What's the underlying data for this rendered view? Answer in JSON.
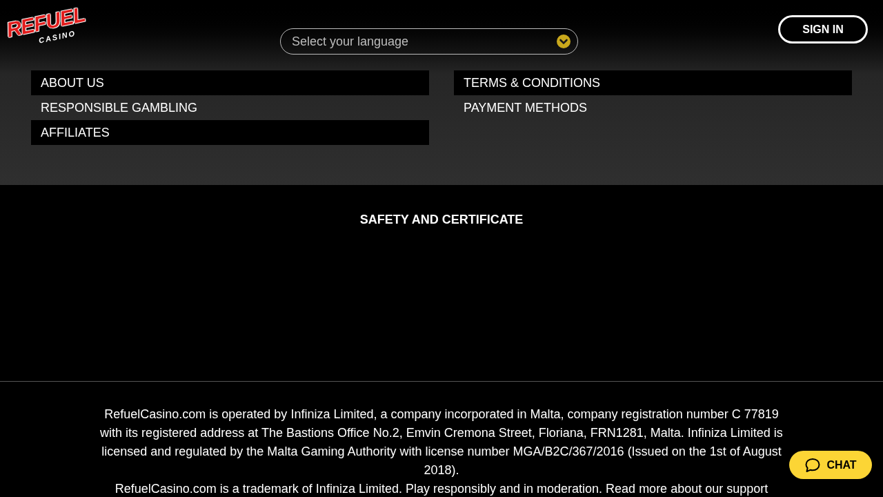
{
  "logo": {
    "word": "REFUEL",
    "sub": "CASINO"
  },
  "language_select": {
    "placeholder": "Select your language"
  },
  "sign_in": "SIGN IN",
  "footer_links": {
    "columns": [
      [
        "ABOUT US",
        "RESPONSIBLE GAMBLING",
        "AFFILIATES"
      ],
      [
        "TERMS & CONDITIONS",
        "PAYMENT METHODS"
      ]
    ]
  },
  "safety": {
    "title": "SAFETY AND CERTIFICATE"
  },
  "legal": {
    "paragraphs": [
      "RefuelCasino.com is operated by Infiniza Limited, a company incorporated in Malta, company registration number C 77819 with its registered address at The Bastions Office No.2, Emvin Cremona Street, Floriana, FRN1281, Malta. Infiniza Limited is licensed and regulated by the Malta Gaming Authority with license number MGA/B2C/367/2016 (Issued on the 1st of August 2018).",
      "RefuelCasino.com is a trademark of Infiniza Limited. Play responsibly and in moderation. Read more about our support"
    ]
  },
  "chat_button": "CHAT"
}
